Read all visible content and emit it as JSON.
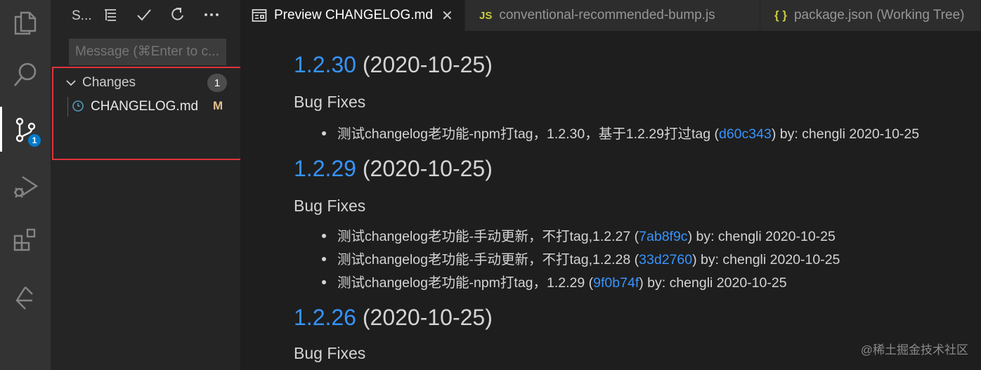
{
  "sidebar": {
    "title": "S...",
    "actions": [
      "tree-view-icon",
      "check-icon",
      "refresh-icon",
      "more-icon"
    ],
    "message_placeholder": "Message (⌘Enter to c...",
    "changes_label": "Changes",
    "changes_count": "1",
    "files": [
      {
        "name": "CHANGELOG.md",
        "status": "M"
      }
    ]
  },
  "activity_bar": {
    "items": [
      "explorer-icon",
      "search-icon",
      "source-control-icon",
      "run-debug-icon",
      "extensions-icon",
      "git-graph-icon"
    ],
    "scm_badge": "1"
  },
  "tabs": [
    {
      "label": "Preview CHANGELOG.md",
      "icon": "preview-icon",
      "active": true,
      "close": "✕"
    },
    {
      "label": "conventional-recommended-bump.js",
      "icon": "JS",
      "active": false
    },
    {
      "label": "package.json (Working Tree)",
      "icon": "{ }",
      "active": false
    }
  ],
  "preview": {
    "releases": [
      {
        "version": "1.2.30",
        "date": "(2020-10-25)",
        "section": "Bug Fixes",
        "commits": [
          {
            "text": "测试changelog老功能-npm打tag，1.2.30，基于1.2.29打过tag (",
            "hash": "d60c343",
            "suffix": ") by: chengli 2020-10-25"
          }
        ]
      },
      {
        "version": "1.2.29",
        "date": "(2020-10-25)",
        "section": "Bug Fixes",
        "commits": [
          {
            "text": "测试changelog老功能-手动更新，不打tag,1.2.27 (",
            "hash": "7ab8f9c",
            "suffix": ") by: chengli 2020-10-25"
          },
          {
            "text": "测试changelog老功能-手动更新，不打tag,1.2.28 (",
            "hash": "33d2760",
            "suffix": ") by: chengli 2020-10-25"
          },
          {
            "text": "测试changelog老功能-npm打tag，1.2.29 (",
            "hash": "9f0b74f",
            "suffix": ") by: chengli 2020-10-25"
          }
        ]
      },
      {
        "version": "1.2.26",
        "date": "(2020-10-25)",
        "section": "Bug Fixes",
        "commits": []
      }
    ]
  },
  "watermark": "@稀土掘金技术社区",
  "colors": {
    "link": "#3794ff",
    "modified": "#e2c08d",
    "badge": "#007acc",
    "highlight": "#e0343c"
  }
}
